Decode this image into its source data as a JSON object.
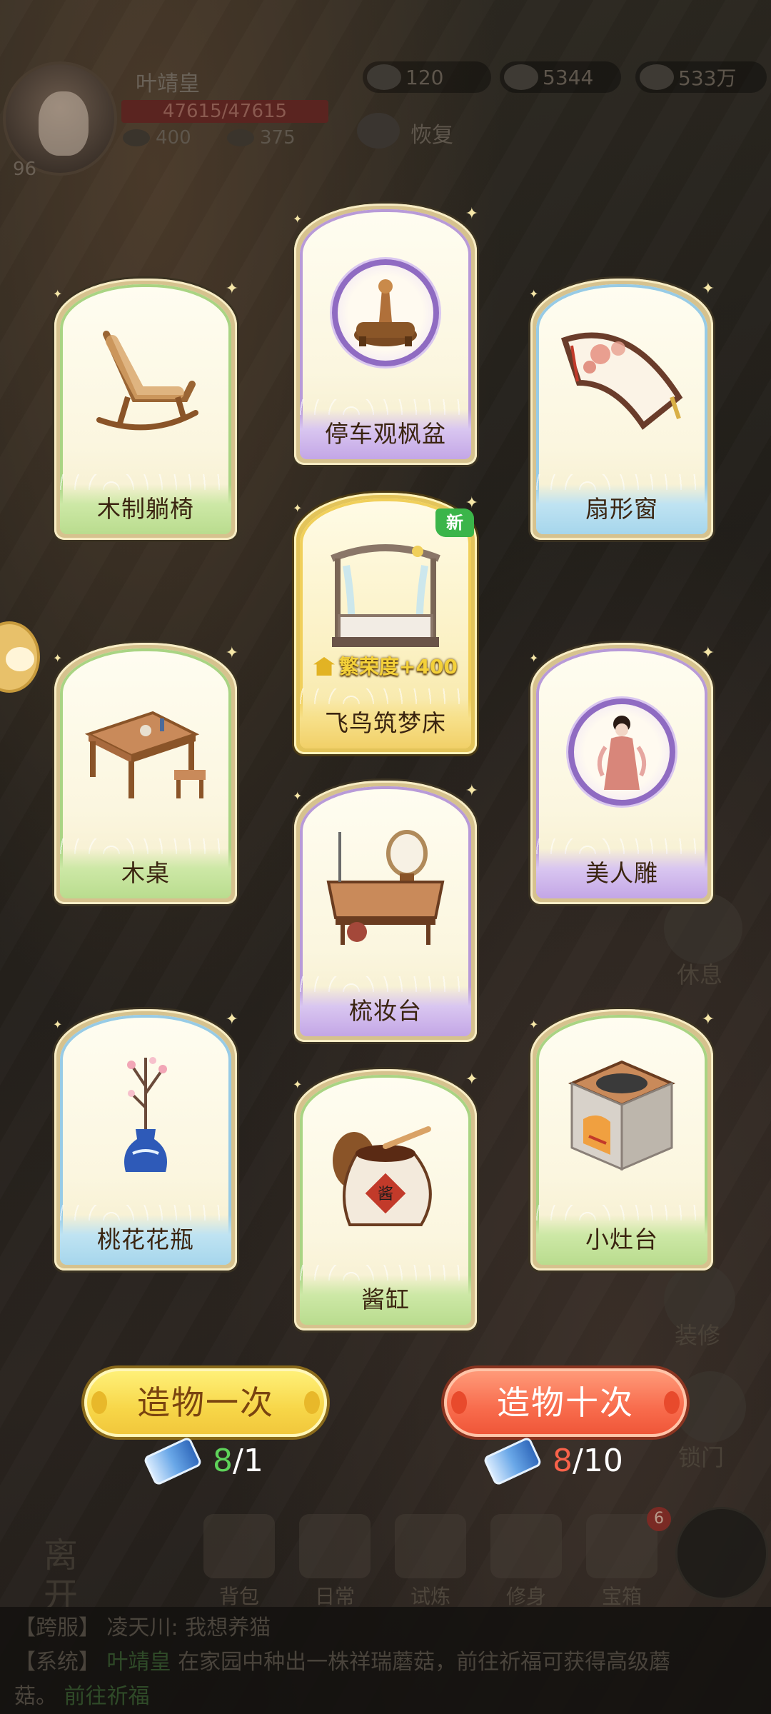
{
  "hud": {
    "player_name": "叶靖皇",
    "level": "96",
    "hp": "47615/47615",
    "stat_a": "400",
    "stat_b": "375",
    "res_1": "120",
    "res_2": "5344",
    "res_3": "533万",
    "recover": "恢复"
  },
  "side": {
    "rest": "休息",
    "decorate": "装修",
    "lock_door": "锁门"
  },
  "cards": [
    {
      "id": "card-1",
      "label": "木制躺椅",
      "rarity": "green"
    },
    {
      "id": "card-2",
      "label": "停车观枫盆",
      "rarity": "purple"
    },
    {
      "id": "card-3",
      "label": "扇形窗",
      "rarity": "blue"
    },
    {
      "id": "card-4",
      "label": "飞鸟筑梦床",
      "rarity": "gold",
      "new_badge": "新",
      "bonus": "繁荣度+400"
    },
    {
      "id": "card-5",
      "label": "木桌",
      "rarity": "green"
    },
    {
      "id": "card-6",
      "label": "美人雕",
      "rarity": "purple"
    },
    {
      "id": "card-7",
      "label": "梳妆台",
      "rarity": "purple"
    },
    {
      "id": "card-8",
      "label": "桃花花瓶",
      "rarity": "blue"
    },
    {
      "id": "card-9",
      "label": "小灶台",
      "rarity": "green"
    },
    {
      "id": "card-10",
      "label": "酱缸",
      "rarity": "green"
    }
  ],
  "actions": {
    "draw_once": "造物一次",
    "draw_ten": "造物十次",
    "once_have": "8",
    "once_need": "/1",
    "ten_have": "8",
    "ten_need": "/10"
  },
  "nav": {
    "leave": "离开",
    "bag": "背包",
    "daily": "日常",
    "trial": "试炼",
    "cultivate": "修身",
    "chest": "宝箱",
    "chest_badge": "6"
  },
  "chat": {
    "line1_tag": "【跨服】",
    "line1_text": "凌天川: 我想养猫",
    "line2_tag": "【系统】",
    "line2_name": "叶靖皇",
    "line2_text": "在家园中种出一株祥瑞蘑菇，前往祈福可获得高级蘑",
    "line3_text": "菇。",
    "line3_link": "前往祈福"
  },
  "colors": {
    "green_rim": "#a9d483",
    "blue_rim": "#97cbe6",
    "purple_rim": "#b89ad8",
    "gold_rim": "#f0cf5a",
    "draw_once_bg": "#f7d648",
    "draw_ten_bg": "#f86b4c"
  }
}
